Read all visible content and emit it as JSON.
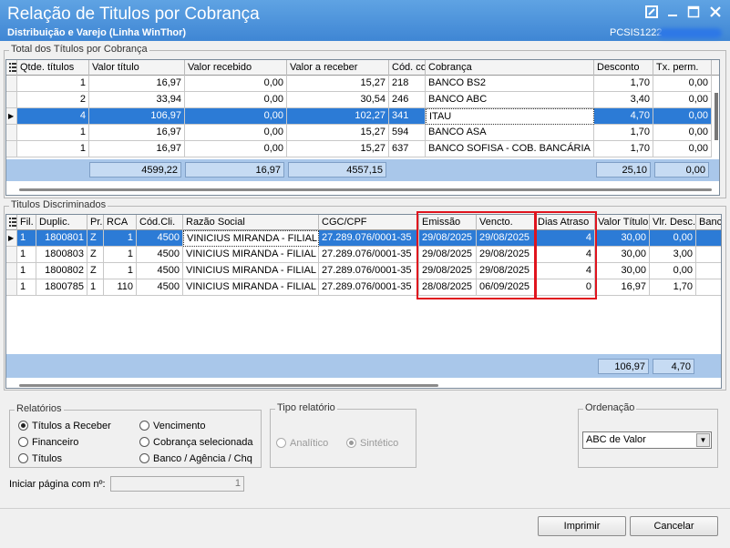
{
  "window": {
    "title": "Relação de Titulos por Cobrança",
    "subtitle": "Distribuição e Varejo (Linha WinThor)",
    "code": "PCSIS1222",
    "icons": [
      "restore-icon",
      "minimize-icon",
      "maximize-icon",
      "close-icon"
    ]
  },
  "total_group": {
    "caption": "Total dos Títulos por Cobrança",
    "headers": [
      "Qtde. títulos",
      "Valor título",
      "Valor recebido",
      "Valor a receber",
      "Cód. co",
      "Cobrança",
      "Desconto",
      "Tx. perm."
    ],
    "rows": [
      [
        "1",
        "16,97",
        "0,00",
        "15,27",
        "218",
        "BANCO BS2",
        "1,70",
        "0,00"
      ],
      [
        "2",
        "33,94",
        "0,00",
        "30,54",
        "246",
        "BANCO ABC",
        "3,40",
        "0,00"
      ],
      [
        "4",
        "106,97",
        "0,00",
        "102,27",
        "341",
        "ITAU",
        "4,70",
        "0,00"
      ],
      [
        "1",
        "16,97",
        "0,00",
        "15,27",
        "594",
        "BANCO ASA",
        "1,70",
        "0,00"
      ],
      [
        "1",
        "16,97",
        "0,00",
        "15,27",
        "637",
        "BANCO SOFISA - COB. BANCÁRIA",
        "1,70",
        "0,00"
      ]
    ],
    "selected_row": 2,
    "totals": {
      "valor_titulo": "4599,22",
      "valor_recebido": "16,97",
      "valor_a_receber": "4557,15",
      "desconto": "25,10",
      "tx_perm": "0,00"
    }
  },
  "titles_group": {
    "caption": "Titulos Discriminados",
    "headers": [
      "Fil.",
      "Duplic.",
      "Pr.",
      "RCA",
      "Cód.Cli.",
      "Razão Social",
      "CGC/CPF",
      "Emissão",
      "Vencto.",
      "Dias Atraso",
      "Valor Título",
      "Vlr. Desc.",
      "Banco"
    ],
    "rows": [
      [
        "1",
        "1800801",
        "Z",
        "1",
        "4500",
        "VINICIUS MIRANDA - FILIAL I",
        "27.289.076/0001-35",
        "29/08/2025",
        "29/08/2025",
        "4",
        "30,00",
        "0,00",
        ""
      ],
      [
        "1",
        "1800803",
        "Z",
        "1",
        "4500",
        "VINICIUS MIRANDA - FILIAL I",
        "27.289.076/0001-35",
        "29/08/2025",
        "29/08/2025",
        "4",
        "30,00",
        "3,00",
        ""
      ],
      [
        "1",
        "1800802",
        "Z",
        "1",
        "4500",
        "VINICIUS MIRANDA - FILIAL I",
        "27.289.076/0001-35",
        "29/08/2025",
        "29/08/2025",
        "4",
        "30,00",
        "0,00",
        ""
      ],
      [
        "1",
        "1800785",
        "1",
        "110",
        "4500",
        "VINICIUS MIRANDA - FILIAL I",
        "27.289.076/0001-35",
        "28/08/2025",
        "06/09/2025",
        "0",
        "16,97",
        "1,70",
        ""
      ]
    ],
    "totals": {
      "valor_titulo": "106,97",
      "vlr_desc": "4,70"
    },
    "highlight_color": "#e0141e"
  },
  "relatorios": {
    "caption": "Relatórios",
    "options": [
      "Títulos a Receber",
      "Financeiro",
      "Títulos",
      "Vencimento",
      "Cobrança selecionada",
      "Banco / Agência / Chq"
    ],
    "selected": "Títulos a Receber"
  },
  "tipo_relatorio": {
    "caption": "Tipo relatório",
    "options": [
      "Analítico",
      "Sintético"
    ],
    "selected": "Sintético"
  },
  "ordenacao": {
    "caption": "Ordenação",
    "value": "ABC de Valor"
  },
  "page_start": {
    "label": "Iniciar página com nº:",
    "value": "1"
  },
  "buttons": {
    "print": "Imprimir",
    "cancel": "Cancelar"
  },
  "colors": {
    "title_bar": "#4a93dc",
    "selection": "#2c7bd6",
    "totals_bg": "#a9c7ea"
  }
}
